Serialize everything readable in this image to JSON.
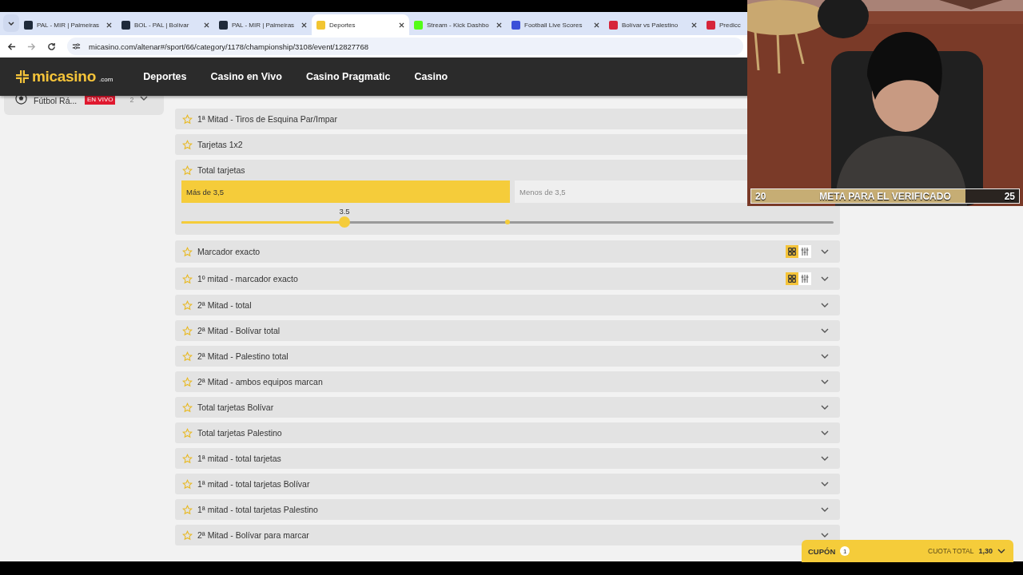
{
  "browser": {
    "tabs": [
      {
        "title": "PAL - MIR | Palmeiras",
        "selected": false,
        "color": "#1f2a3a"
      },
      {
        "title": "BOL - PAL | Bolívar",
        "selected": false,
        "color": "#1f2a3a"
      },
      {
        "title": "PAL - MIR | Palmeiras",
        "selected": false,
        "color": "#1f2a3a"
      },
      {
        "title": "Deportes",
        "selected": true,
        "color": "#f2c531"
      },
      {
        "title": "Stream - Kick Dashbo",
        "selected": false,
        "color": "#53fc18"
      },
      {
        "title": "Football Live Scores",
        "selected": false,
        "color": "#3b4fd8"
      },
      {
        "title": "Bolívar vs Palestino",
        "selected": false,
        "color": "#d6243a"
      },
      {
        "title": "Predicc",
        "selected": false,
        "color": "#d6243a"
      }
    ],
    "url": "micasino.com/altenar#/sport/66/category/1178/championship/3108/event/12827768"
  },
  "site_header": {
    "logo": {
      "name": "micasino",
      "suffix": ".com"
    },
    "nav": [
      "Deportes",
      "Casino en Vivo",
      "Casino Pragmatic",
      "Casino"
    ]
  },
  "sidebar": {
    "items": [
      {
        "label": "Fútbol Rá...",
        "badge": "EN VIVO",
        "count": "2"
      }
    ]
  },
  "markets": [
    {
      "kind": "title-only",
      "title": "1ª Mitad - Tiros de Esquina Par/Impar"
    },
    {
      "kind": "title-only",
      "title": "Tarjetas 1x2"
    },
    {
      "kind": "options",
      "title": "Total tarjetas",
      "options": [
        {
          "label": "Más de 3,5",
          "selected": true
        },
        {
          "label": "Menos de 3,5",
          "selected": false
        }
      ],
      "slider": {
        "reading": "3.5",
        "level": 0.25
      }
    },
    {
      "kind": "view-toggle",
      "title": "Marcador exacto",
      "grid_selected": true
    },
    {
      "kind": "view-toggle",
      "title": "1º mitad - marcador exacto",
      "grid_selected": true
    },
    {
      "kind": "collapsed",
      "title": "2ª Mitad - total"
    },
    {
      "kind": "collapsed",
      "title": "2ª Mitad - Bolívar total"
    },
    {
      "kind": "collapsed",
      "title": "2ª Mitad - Palestino total"
    },
    {
      "kind": "collapsed",
      "title": "2ª Mitad - ambos equipos marcan"
    },
    {
      "kind": "collapsed",
      "title": "Total tarjetas Bolívar"
    },
    {
      "kind": "collapsed",
      "title": "Total tarjetas Palestino"
    },
    {
      "kind": "collapsed",
      "title": "1ª mitad - total tarjetas"
    },
    {
      "kind": "collapsed",
      "title": "1ª mitad - total tarjetas Bolívar"
    },
    {
      "kind": "collapsed",
      "title": "1ª mitad - total tarjetas Palestino"
    },
    {
      "kind": "collapsed",
      "title": "2ª Mitad - Bolívar para marcar"
    }
  ],
  "stream_overlay": {
    "goal": {
      "start": "20",
      "label": "META PARA EL VERIFICADO",
      "end": "25",
      "level": 0.8
    }
  },
  "coupon": {
    "label": "CUPÓN",
    "count": "1",
    "total_label": "CUOTA TOTAL",
    "total": "1,30"
  }
}
